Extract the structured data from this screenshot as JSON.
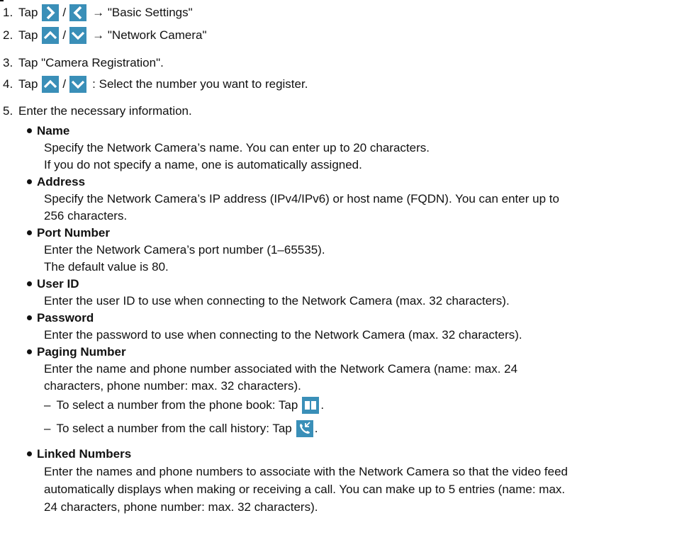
{
  "steps": [
    {
      "num": "1.",
      "pre": "Tap",
      "sep": "/",
      "post": "→ \"Basic Settings\"",
      "icons": [
        "chevron-right-icon",
        "chevron-left-icon"
      ]
    },
    {
      "num": "2.",
      "pre": "Tap",
      "sep": "/",
      "post": "→ \"Network Camera\"",
      "icons": [
        "chevron-up-icon",
        "chevron-down-icon"
      ]
    },
    {
      "num": "3.",
      "text": "Tap \"Camera Registration\"."
    },
    {
      "num": "4.",
      "pre": "Tap",
      "sep": "/",
      "post": ": Select the number you want to register.",
      "icons": [
        "chevron-up-icon",
        "chevron-down-icon"
      ]
    },
    {
      "num": "5.",
      "text": "Enter the necessary information."
    }
  ],
  "fields": {
    "name": {
      "title": "Name",
      "lines": [
        "Specify the Network Camera’s name. You can enter up to 20 characters.",
        "If you do not specify a name, one is automatically assigned."
      ]
    },
    "address": {
      "title": "Address",
      "lines": [
        "Specify the Network Camera’s IP address (IPv4/IPv6) or host name (FQDN). You can enter up to",
        "256 characters."
      ]
    },
    "port": {
      "title": "Port Number",
      "lines": [
        "Enter the Network Camera’s port number (1–65535).",
        "The default value is 80."
      ]
    },
    "user_id": {
      "title": "User ID",
      "lines": [
        "Enter the user ID to use when connecting to the Network Camera (max. 32 characters)."
      ]
    },
    "password": {
      "title": "Password",
      "lines": [
        "Enter the password to use when connecting to the Network Camera (max. 32 characters)."
      ]
    },
    "paging": {
      "title": "Paging Number",
      "lines": [
        "Enter the name and phone number associated with the Network Camera (name: max. 24",
        "characters, phone number: max. 32 characters)."
      ],
      "sub": [
        {
          "dash": "–",
          "text": "To select a number from the phone book: Tap",
          "end": ".",
          "icon": "phone-book-icon"
        },
        {
          "dash": "–",
          "text": "To select a number from the call history: Tap",
          "end": ".",
          "icon": "call-history-icon"
        }
      ]
    },
    "linked": {
      "title": "Linked Numbers",
      "lines": [
        "Enter the names and phone numbers to associate with the Network Camera so that the video feed",
        "automatically displays when making or receiving a call. You can make up to 5 entries (name: max.",
        "24 characters, phone number: max. 32 characters)."
      ]
    }
  },
  "colors": {
    "icon_bg": "#3a8fb8",
    "text": "#111111"
  }
}
